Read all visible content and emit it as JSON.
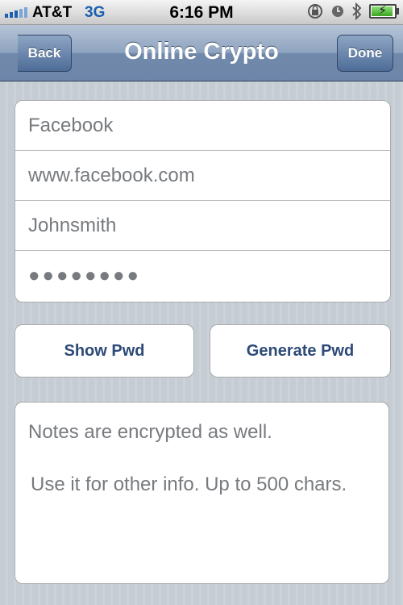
{
  "status_bar": {
    "carrier": "AT&T",
    "network": "3G",
    "time": "6:16 PM",
    "icons": [
      "signal-icon",
      "orientation-lock-icon",
      "alarm-icon",
      "bluetooth-icon",
      "battery-charging-icon"
    ]
  },
  "navbar": {
    "title": "Online Crypto",
    "back_label": "Back",
    "done_label": "Done"
  },
  "fields": {
    "name": "Facebook",
    "url": "www.facebook.com",
    "username": "Johnsmith",
    "password": "●●●●●●●●"
  },
  "buttons": {
    "show_pwd": "Show Pwd",
    "generate_pwd": "Generate Pwd"
  },
  "notes": {
    "line1": "Notes are encrypted as well.",
    "line2": "Use it for other info. Up to 500 chars."
  },
  "colors": {
    "nav_blue": "#6d86a9",
    "button_text": "#2d4a78",
    "field_text": "#777a7e",
    "background": "#c5ccd4"
  }
}
